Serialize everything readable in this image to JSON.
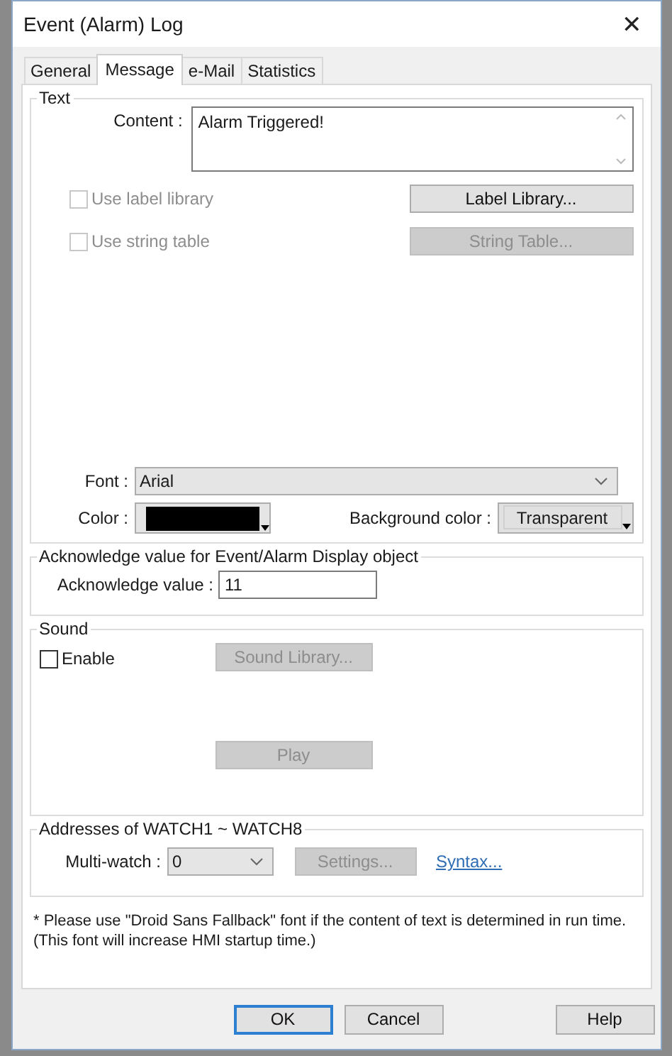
{
  "window": {
    "title": "Event (Alarm) Log",
    "close": "✕"
  },
  "tabs": [
    {
      "label": "General",
      "selected": false
    },
    {
      "label": "Message",
      "selected": true
    },
    {
      "label": "e-Mail",
      "selected": false
    },
    {
      "label": "Statistics",
      "selected": false
    }
  ],
  "text_group": {
    "title": "Text",
    "content": {
      "label": "Content :",
      "value": "Alarm Triggered!"
    },
    "options": [
      {
        "label": "Use label library",
        "checked": false,
        "disabled": true
      },
      {
        "label": "Use string table",
        "checked": false,
        "disabled": true
      }
    ],
    "buttons": [
      {
        "label": "Label Library...",
        "disabled": false
      },
      {
        "label": "String Table...",
        "disabled": true
      }
    ],
    "font": {
      "label": "Font :",
      "value": "Arial"
    },
    "color": {
      "label": "Color :",
      "color": "#000000"
    },
    "background_color": {
      "label": "Background color :",
      "value": "Transparent"
    }
  },
  "acknowledge": {
    "title": "Acknowledge value for Event/Alarm Display object",
    "label": "Acknowledge value :",
    "value": "11"
  },
  "sound": {
    "title": "Sound",
    "enable": {
      "label": "Enable",
      "checked": false,
      "disabled": false
    },
    "buttons": [
      {
        "label": "Sound Library...",
        "disabled": true
      },
      {
        "label": "Play",
        "disabled": true
      }
    ]
  },
  "addresses": {
    "title": "Addresses of WATCH1 ~ WATCH8",
    "label": "Multi-watch :",
    "value": "0",
    "settings_button": {
      "label": "Settings...",
      "disabled": true
    },
    "link": "Syntax..."
  },
  "note": [
    "* Please use \"Droid Sans Fallback\" font if the content of text is determined in run time.",
    "(This font will increase HMI startup time.)"
  ],
  "footer_buttons": [
    {
      "label": "OK",
      "kind": "default"
    },
    {
      "label": "Cancel",
      "kind": "normal"
    },
    {
      "label": "Help",
      "kind": "normal"
    }
  ]
}
